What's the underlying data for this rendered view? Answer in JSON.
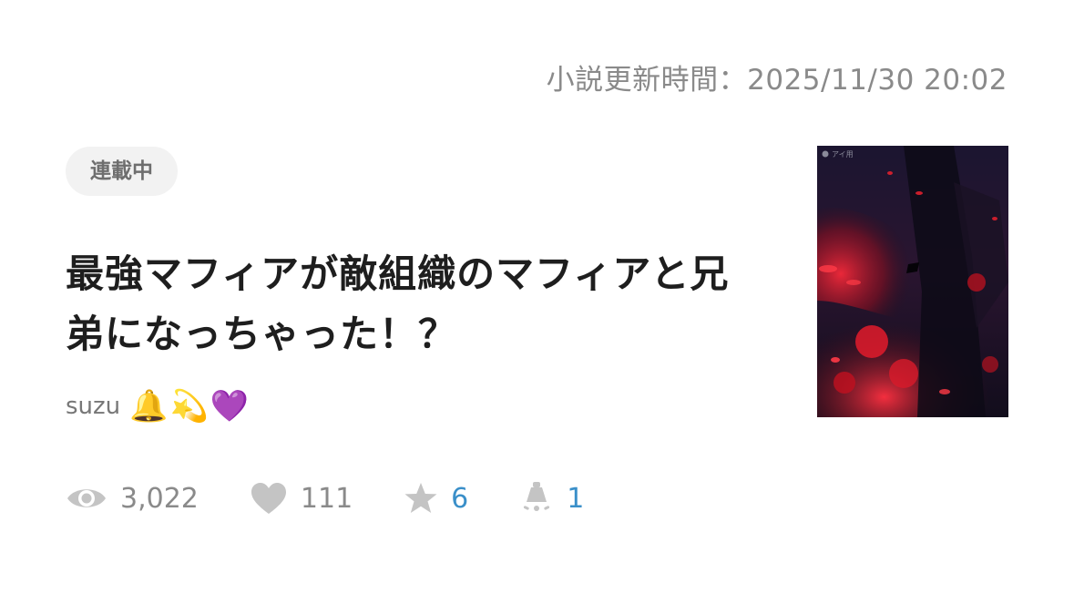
{
  "header": {
    "updated_text": "小説更新時間：2025/11/30 20:02"
  },
  "novel": {
    "status": "連載中",
    "title": "最強マフィアが敵組織のマフィアと兄弟になっちゃった！？",
    "author": "suzu",
    "author_emojis": "🔔💫💜",
    "cover_tag": "アイ用"
  },
  "stats": {
    "views": "3,022",
    "likes": "111",
    "stars": "6",
    "comments": "1"
  },
  "colors": {
    "muted_text": "#8a8a8a",
    "accent_blue": "#3a8fc9",
    "pill_bg": "#f2f2f2",
    "icon_gray": "#c4c4c4"
  },
  "icons": {
    "views": "eye-icon",
    "likes": "heart-icon",
    "stars": "star-icon",
    "comments": "spotlight-icon"
  }
}
